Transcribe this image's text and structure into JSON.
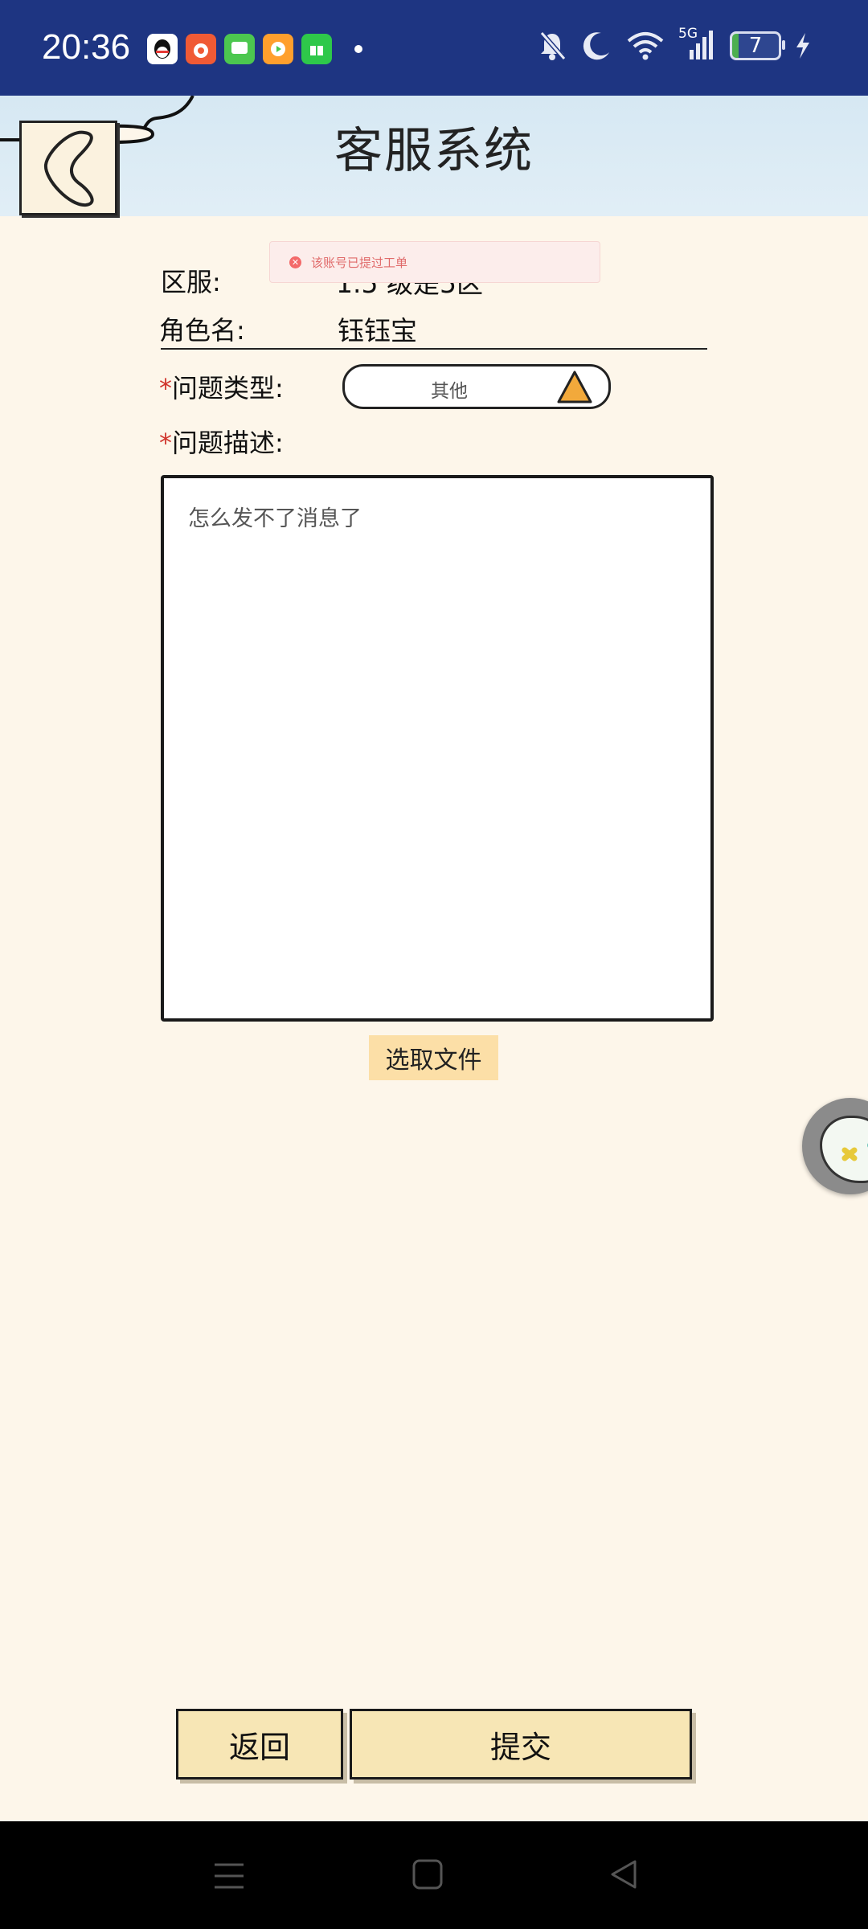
{
  "status_bar": {
    "time": "20:36",
    "battery_level": "7",
    "network": "5G"
  },
  "header": {
    "title": "客服系统"
  },
  "toast": {
    "message": "该账号已提过工单"
  },
  "form": {
    "server_label": "区服:",
    "server_value": "1.5 级是5区",
    "role_label": "角色名:",
    "role_value": "钰钰宝",
    "type_required": "*",
    "type_label": "问题类型:",
    "type_value": "其他",
    "desc_required": "*",
    "desc_label": "问题描述:",
    "desc_value": "怎么发不了消息了",
    "file_button": "选取文件"
  },
  "actions": {
    "back_label": "返回",
    "submit_label": "提交"
  },
  "colors": {
    "status_bar": "#1e3582",
    "page_bg": "#fdf6ea",
    "button_bg": "#f7e6b5",
    "file_button_bg": "#fcdfa7",
    "required_star": "#d0342c"
  }
}
